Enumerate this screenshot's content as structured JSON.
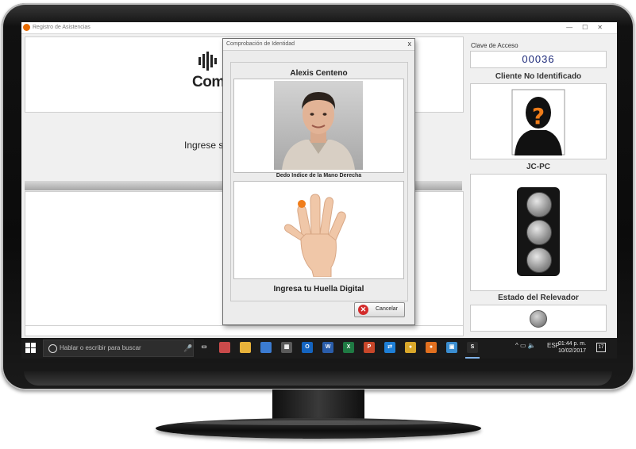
{
  "window": {
    "title": "Registro de Asistencias",
    "controls": [
      "—",
      "☐",
      "✕"
    ]
  },
  "main": {
    "logo_text": "Comp",
    "prompt": "Ingrese s"
  },
  "right_panel": {
    "clave_label": "Clave de Acceso",
    "clave_value": "00036",
    "cliente_label": "Cliente No Identificado",
    "cliente_mark": "?",
    "pc_label": "JC-PC",
    "estado_label": "Estado del Relevador"
  },
  "dialog": {
    "title": "Comprobación de Identidad",
    "close": "x",
    "person_name": "Alexis Centeno",
    "finger_label": "Dedo Indice de la Mano Derecha",
    "instruction": "Ingresa tu Huella Digital",
    "cancel_label": "Cancelar",
    "cancel_icon": "✕"
  },
  "taskbar": {
    "search_placeholder": "Hablar o escribir para buscar",
    "mic_icon": "🎤",
    "apps": [
      {
        "name": "task-view-icon",
        "color": "#1b1b1b",
        "glyph": "▭"
      },
      {
        "name": "app-icon",
        "color": "#c94a4a",
        "glyph": ""
      },
      {
        "name": "file-explorer-icon",
        "color": "#e8b23a",
        "glyph": ""
      },
      {
        "name": "network-icon",
        "color": "#3b7bd1",
        "glyph": ""
      },
      {
        "name": "calculator-icon",
        "color": "#5a5a5a",
        "glyph": "▦"
      },
      {
        "name": "outlook-icon",
        "color": "#1464c0",
        "glyph": "O"
      },
      {
        "name": "word-icon",
        "color": "#2a5daa",
        "glyph": "W"
      },
      {
        "name": "excel-icon",
        "color": "#1f7a43",
        "glyph": "X"
      },
      {
        "name": "powerpoint-icon",
        "color": "#c8472a",
        "glyph": "P"
      },
      {
        "name": "teamviewer-icon",
        "color": "#1e7fd6",
        "glyph": "⇄"
      },
      {
        "name": "chrome-icon",
        "color": "#d9a72a",
        "glyph": "●"
      },
      {
        "name": "firefox-icon",
        "color": "#e2701f",
        "glyph": "●"
      },
      {
        "name": "store-icon",
        "color": "#3a8dd0",
        "glyph": "▣"
      },
      {
        "name": "registro-app-icon",
        "color": "#2b2b2b",
        "glyph": "S"
      }
    ],
    "tray_icons": "^ ▭ 🔈",
    "language": "ESP",
    "time": "01:44 p. m.",
    "date": "10/02/2017",
    "notifications": "17"
  },
  "colors": {
    "accent_orange": "#f07d1a",
    "clave_text": "#1d2a7a",
    "taskbar": "#1b1b1b"
  }
}
